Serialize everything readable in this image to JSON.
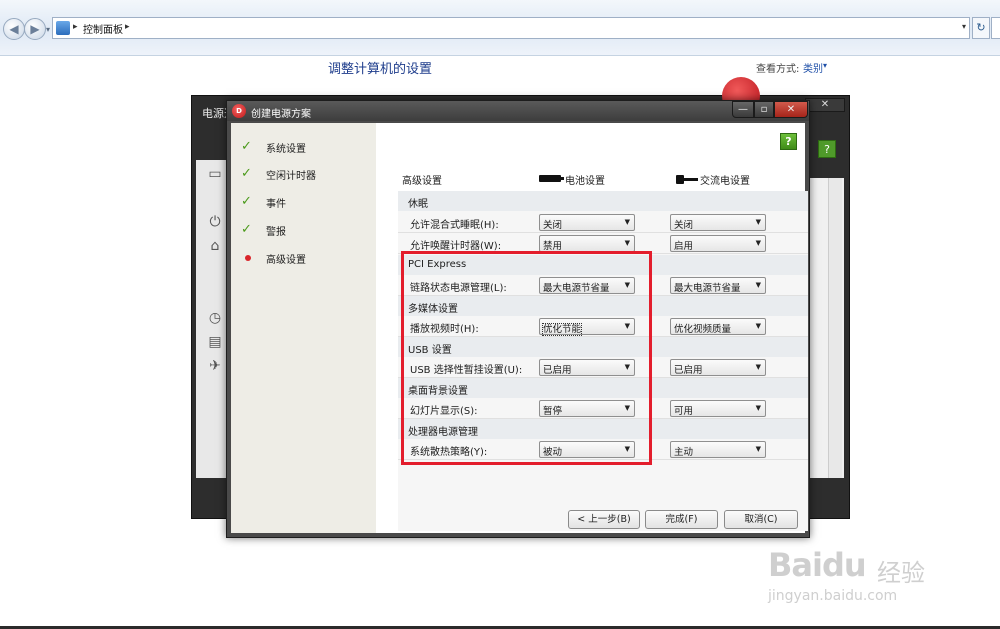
{
  "explorer": {
    "breadcrumb": "控制面板",
    "crumb_sep": "▸",
    "dropdown_glyph": "▾",
    "refresh_glyph": "↻"
  },
  "control_panel": {
    "title": "调整计算机的设置",
    "view_label": "查看方式:",
    "view_value": "类别"
  },
  "bg_window": {
    "title": "电源选",
    "help": "?"
  },
  "dialog": {
    "title": "创建电源方案",
    "controls": {
      "minimize": "—",
      "maximize": "▫",
      "close": "✕"
    },
    "help": "?",
    "nav": [
      {
        "label": "系统设置",
        "state": "done"
      },
      {
        "label": "空闲计时器",
        "state": "done"
      },
      {
        "label": "事件",
        "state": "done"
      },
      {
        "label": "警报",
        "state": "done"
      },
      {
        "label": "高级设置",
        "state": "current"
      }
    ],
    "headers": {
      "advanced": "高级设置",
      "battery": "电池设置",
      "ac": "交流电设置"
    },
    "groups": [
      {
        "title": "休眠",
        "rows": [
          {
            "label": "允许混合式睡眠(H):",
            "battery": "关闭",
            "ac": "关闭"
          },
          {
            "label": "允许唤醒计时器(W):",
            "battery": "禁用",
            "ac": "启用"
          }
        ]
      },
      {
        "title": "PCI Express",
        "rows": [
          {
            "label": "链路状态电源管理(L):",
            "battery": "最大电源节省量",
            "ac": "最大电源节省量"
          }
        ]
      },
      {
        "title": "多媒体设置",
        "rows": [
          {
            "label": "播放视频时(H):",
            "battery": "优化节能",
            "ac": "优化视频质量"
          }
        ]
      },
      {
        "title": "USB 设置",
        "rows": [
          {
            "label": "USB 选择性暂挂设置(U):",
            "battery": "已启用",
            "ac": "已启用"
          }
        ]
      },
      {
        "title": "桌面背景设置",
        "rows": [
          {
            "label": "幻灯片显示(S):",
            "battery": "暂停",
            "ac": "可用"
          }
        ]
      },
      {
        "title": "处理器电源管理",
        "rows": [
          {
            "label": "系统散热策略(Y):",
            "battery": "被动",
            "ac": "主动"
          }
        ]
      }
    ],
    "buttons": {
      "back": "< 上一步(B)",
      "finish": "完成(F)",
      "cancel": "取消(C)"
    }
  },
  "watermark": {
    "logo": "Baidu",
    "text": "经验",
    "url": "jingyan.baidu.com"
  },
  "colors": {
    "highlight_box": "#e31d2c",
    "check": "#4a9a1a",
    "current_dot": "#d9252a",
    "link": "#1e4fa8"
  }
}
